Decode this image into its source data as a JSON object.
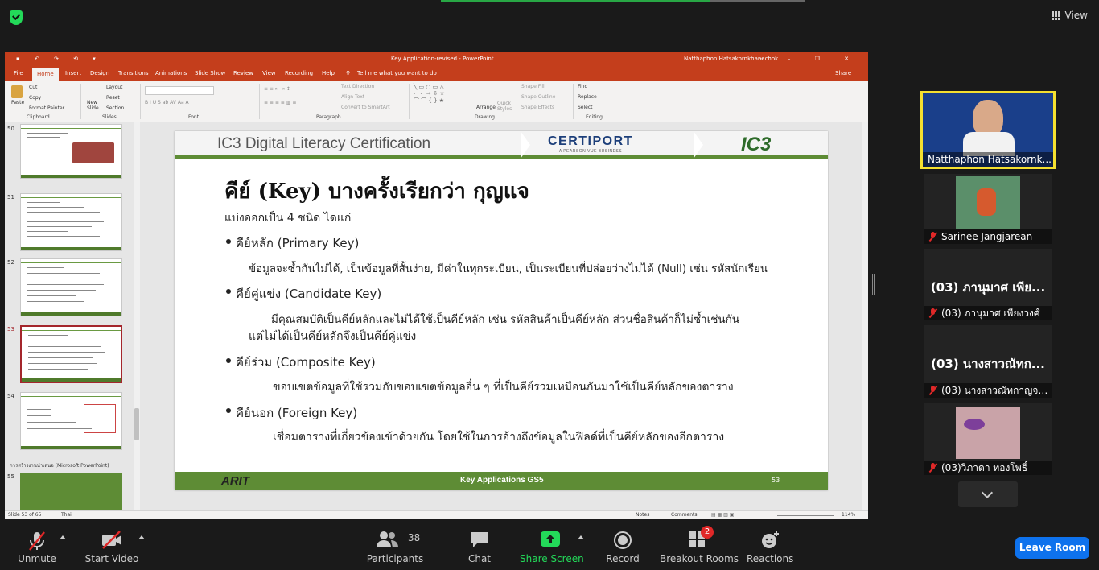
{
  "topbar": {
    "view_label": "View"
  },
  "ppt": {
    "window_title": "Key Application-revised  -  PowerPoint",
    "user": "Natthaphon Hatsakornkhanachok",
    "menu": [
      "File",
      "Home",
      "Insert",
      "Design",
      "Transitions",
      "Animations",
      "Slide Show",
      "Review",
      "View",
      "Recording",
      "Help"
    ],
    "tell_me": "Tell me what you want to do",
    "share": "Share",
    "ribbon": {
      "paste": "Paste",
      "cut": "Cut",
      "copy": "Copy",
      "format_painter": "Format Painter",
      "new_slide": "New Slide",
      "layout": "Layout",
      "reset": "Reset",
      "section": "Section",
      "text_direction": "Text Direction",
      "align_text": "Align Text",
      "convert_smartart": "Convert to SmartArt",
      "arrange": "Arrange",
      "quick_styles": "Quick Styles",
      "shape_fill": "Shape Fill",
      "shape_outline": "Shape Outline",
      "shape_effects": "Shape Effects",
      "find": "Find",
      "replace": "Replace",
      "select": "Select",
      "groups": [
        "Clipboard",
        "Slides",
        "Font",
        "Paragraph",
        "Drawing",
        "Editing"
      ]
    },
    "thumbnails": [
      "50",
      "51",
      "52",
      "53",
      "54",
      "55"
    ],
    "section_label": "การสร้างงานนำเสนอ (Microsoft PowerPoint)",
    "status_slide": "Slide 53 of 65",
    "status_lang": "Thai",
    "status_notes": "Notes",
    "status_comments": "Comments",
    "zoom": "114%"
  },
  "slide": {
    "header_title": "IC3 Digital Literacy Certification",
    "certiport": "CERTIPORT",
    "certiport_sub": "A PEARSON VUE BUSINESS",
    "ic3": "IC3",
    "title": "คีย์ (Key) บางครั้งเรียกว่า กุญแจ",
    "intro": "แบ่งออกเป็น 4 ชนิด ไดแก่",
    "b1_head": "คีย์หลัก (Primary Key)",
    "b1_text": "ข้อมูลจะซ้ำกันไม่ได้, เป็นข้อมูลที่สั้นง่าย, มีค่าในทุกระเบียน, เป็นระเบียนที่ปล่อยว่างไม่ได้ (Null) เช่น รหัสนักเรียน",
    "b2_head": "คีย์คู่แข่ง (Candidate Key)",
    "b2_text1": "มีคุณสมบัติเป็นคีย์หลักและไม่ได้ใช้เป็นคีย์หลัก เช่น รหัสสินค้าเป็นคีย์หลัก ส่วนชื่อสินค้าก็ไม่ซ้ำเช่นกัน",
    "b2_text2": "แต่ไม่ได้เป็นคีย์หลักจึงเป็นคีย์คู่แข่ง",
    "b3_head": "คีย์ร่วม (Composite Key)",
    "b3_text": "ขอบเขตข้อมูลที่ใช้รวมกับขอบเขตข้อมูลอื่น ๆ ที่เป็นคีย์รวมเหมือนกันมาใช้เป็นคีย์หลักของตาราง",
    "b4_head": "คีย์นอก (Foreign Key)",
    "b4_text": "เชื่อมตารางที่เกี่ยวข้องเข้าด้วยกัน โดยใช้ในการอ้างถึงข้อมูลในฟิลด์ที่เป็นคีย์หลักของอีกตาราง",
    "footer_logo": "ARIT",
    "footer_text": "Key Applications GS5",
    "footer_num": "53"
  },
  "participants": [
    {
      "name": "Natthaphon Hatsakornk..."
    },
    {
      "name": "Sarinee Jangjarean"
    },
    {
      "big": "(03) ภานุมาศ เพีย...",
      "name": "(03) ภานุมาศ เพียงวงศ์"
    },
    {
      "big": "(03) นางสาวณัทก...",
      "name": "(03) นางสาวณัทกาญจน์..."
    },
    {
      "name": "(03)วิภาดา ทองโพธิ์"
    }
  ],
  "toolbar": {
    "unmute": "Unmute",
    "start_video": "Start Video",
    "participants": "Participants",
    "participants_count": "38",
    "chat": "Chat",
    "share_screen": "Share Screen",
    "record": "Record",
    "breakout": "Breakout Rooms",
    "breakout_badge": "2",
    "reactions": "Reactions",
    "leave": "Leave Room"
  }
}
